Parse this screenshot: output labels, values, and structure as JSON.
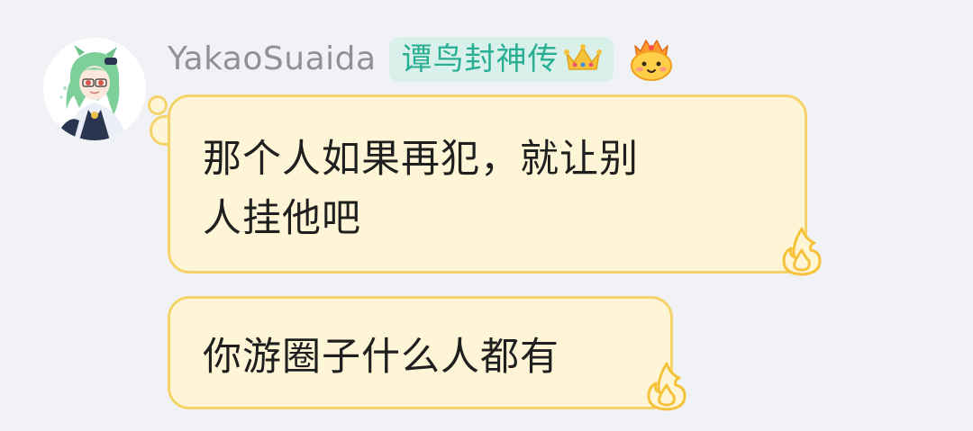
{
  "sender": {
    "name": "YakaoSuaida",
    "title_badge": "谭鸟封神传",
    "badge_text_color": "#27ae93",
    "badge_bg_color": "#d9f1ea",
    "badge_icon": "crown-icon",
    "level_icon": "fire-face-icon",
    "avatar": "anime-character-avatar"
  },
  "messages": [
    {
      "text_line1": "那个人如果再犯，就让别",
      "text_line2": "人挂他吧",
      "decoration_icon": "flame-icon"
    },
    {
      "text": "你游圈子什么人都有",
      "decoration_icon": "flame-icon"
    }
  ],
  "colors": {
    "background": "#f1f2f6",
    "bubble_fill": "#fdf5d6",
    "bubble_border": "#f5d36a",
    "sender_name": "#8f9196",
    "message_text": "#1f1f1f"
  }
}
